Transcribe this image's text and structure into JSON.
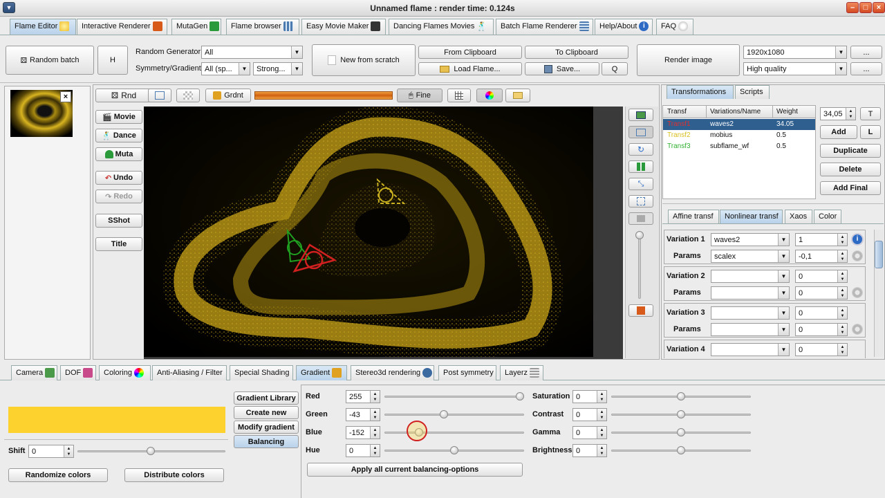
{
  "window": {
    "title": "Unnamed flame : render time: 0.124s"
  },
  "tabs": [
    {
      "label": "Flame Editor"
    },
    {
      "label": "Interactive Renderer"
    },
    {
      "label": "MutaGen"
    },
    {
      "label": "Flame browser"
    },
    {
      "label": "Easy Movie Maker"
    },
    {
      "label": "Dancing Flames Movies"
    },
    {
      "label": "Batch Flame Renderer"
    },
    {
      "label": "Help/About"
    },
    {
      "label": "FAQ"
    }
  ],
  "toolbar": {
    "random_batch": "Random batch",
    "h": "H",
    "random_generator_label": "Random Generator",
    "random_generator_value": "All",
    "symmetry_label": "Symmetry/Gradient",
    "symmetry_value": "All (sp...",
    "strong_value": "Strong...",
    "new_from_scratch": "New from scratch",
    "from_clipboard": "From Clipboard",
    "to_clipboard": "To Clipboard",
    "load_flame": "Load Flame...",
    "save": "Save...",
    "q": "Q",
    "render_image": "Render image",
    "resolution": "1920x1080",
    "quality": "High quality",
    "dots": "..."
  },
  "preview_toolbar": {
    "rnd": "Rnd",
    "grdnt": "Grdnt",
    "fine": "Fine"
  },
  "side_buttons": {
    "movie": "Movie",
    "dance": "Dance",
    "muta": "Muta",
    "undo": "Undo",
    "redo": "Redo",
    "sshot": "SShot",
    "title": "Title"
  },
  "right_panel": {
    "tabs": [
      "Transformations",
      "Scripts"
    ],
    "columns": [
      "Transf",
      "Variations/Name",
      "Weight"
    ],
    "rows": [
      {
        "transf": "Transf1",
        "name": "waves2",
        "weight": "34.05",
        "color": "#e03030"
      },
      {
        "transf": "Transf2",
        "name": "mobius",
        "weight": "0.5",
        "color": "#d8c020"
      },
      {
        "transf": "Transf3",
        "name": "subflame_wf",
        "weight": "0.5",
        "color": "#30b030"
      }
    ],
    "weight_value": "34,05",
    "t": "T",
    "add": "Add",
    "l": "L",
    "duplicate": "Duplicate",
    "delete": "Delete",
    "add_final": "Add Final",
    "sub_tabs": [
      "Affine transf",
      "Nonlinear transf",
      "Xaos",
      "Color"
    ],
    "variations": [
      {
        "label": "Variation 1",
        "value": "waves2",
        "amount": "1",
        "params_label": "Params",
        "param_name": "scalex",
        "param_value": "-0,1"
      },
      {
        "label": "Variation 2",
        "value": "",
        "amount": "0",
        "params_label": "Params",
        "param_name": "",
        "param_value": "0"
      },
      {
        "label": "Variation 3",
        "value": "",
        "amount": "0",
        "params_label": "Params",
        "param_name": "",
        "param_value": "0"
      },
      {
        "label": "Variation 4",
        "value": "",
        "amount": "0"
      }
    ]
  },
  "bottom_tabs": [
    {
      "label": "Camera"
    },
    {
      "label": "DOF"
    },
    {
      "label": "Coloring"
    },
    {
      "label": "Anti-Aliasing / Filter"
    },
    {
      "label": "Special Shading"
    },
    {
      "label": "Gradient"
    },
    {
      "label": "Stereo3d rendering"
    },
    {
      "label": "Post symmetry"
    },
    {
      "label": "Layerz"
    }
  ],
  "gradient": {
    "swatch_color": "#fdd22f",
    "shift_label": "Shift",
    "shift_value": "0",
    "randomize": "Randomize colors",
    "distribute": "Distribute colors",
    "library": "Gradient Library",
    "create_new": "Create new",
    "modify": "Modify gradient",
    "balancing": "Balancing",
    "sliders_left": [
      {
        "label": "Red",
        "value": "255",
        "pos": 1.0
      },
      {
        "label": "Green",
        "value": "-43",
        "pos": 0.42
      },
      {
        "label": "Blue",
        "value": "-152",
        "pos": 0.23
      },
      {
        "label": "Hue",
        "value": "0",
        "pos": 0.5
      }
    ],
    "sliders_right": [
      {
        "label": "Saturation",
        "value": "0",
        "pos": 0.5
      },
      {
        "label": "Contrast",
        "value": "0",
        "pos": 0.5
      },
      {
        "label": "Gamma",
        "value": "0",
        "pos": 0.5
      },
      {
        "label": "Brightness",
        "value": "0",
        "pos": 0.5
      }
    ],
    "apply_all": "Apply all current balancing-options"
  },
  "colors": {
    "accent": "#b9d2ea",
    "selected_row": "#2f5f8f",
    "flame_gold": "#d8b020"
  }
}
